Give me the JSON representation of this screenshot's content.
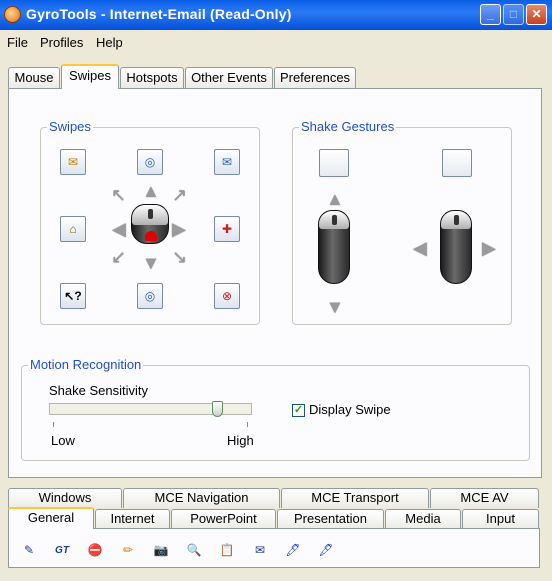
{
  "window": {
    "title": "GyroTools - Internet-Email (Read-Only)",
    "min": "_",
    "max": "□",
    "close": "✕"
  },
  "menu": [
    "File",
    "Profiles",
    "Help"
  ],
  "tabs": [
    "Mouse",
    "Swipes",
    "Hotspots",
    "Other Events",
    "Preferences"
  ],
  "swipes_group": {
    "title": "Swipes"
  },
  "shake_group": {
    "title": "Shake Gestures"
  },
  "motion_group": {
    "title": "Motion Recognition",
    "sensitivity_label": "Shake Sensitivity",
    "low_label": "Low",
    "high_label": "High",
    "sensitivity_value": 0.85,
    "display_swipe_label": "Display Swipe",
    "display_swipe_checked": true
  },
  "bottom_tabs_row1": [
    "Windows",
    "MCE Navigation",
    "MCE Transport",
    "MCE AV"
  ],
  "bottom_tabs_row2": [
    "General",
    "Internet",
    "PowerPoint",
    "Presentation",
    "Media",
    "Input"
  ],
  "icons": {
    "swipe_top_left": "email-read-icon",
    "swipe_top": "globe-up-icon",
    "swipe_top_right": "envelope-icon",
    "swipe_left": "home-icon",
    "swipe_right": "favorite-add-icon",
    "swipe_bottom_left": "help-pointer-icon",
    "swipe_bottom": "globe-down-icon",
    "swipe_bottom_right": "stop-icon",
    "tool_glyphs": [
      "✎",
      "GT",
      "⛔",
      "✏",
      "📷",
      "🔍",
      "📋",
      "✉",
      "🖊",
      "🖋"
    ]
  }
}
